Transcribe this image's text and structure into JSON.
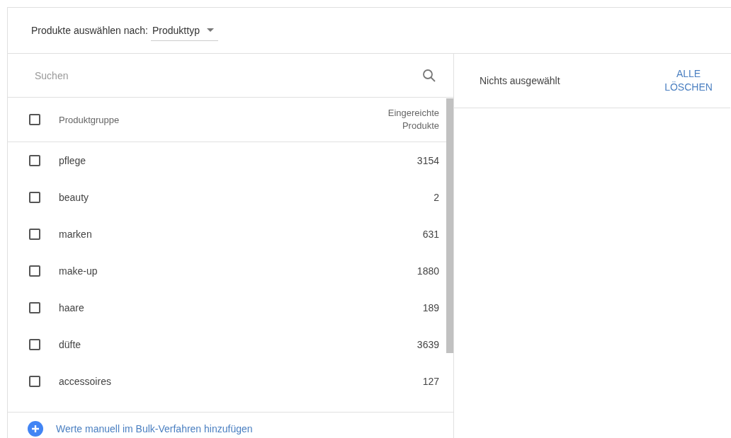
{
  "selector": {
    "label": "Produkte auswählen nach:",
    "value": "Produkttyp"
  },
  "search": {
    "placeholder": "Suchen"
  },
  "table": {
    "header_checked": false,
    "columns": [
      "Produktgruppe",
      "Eingereichte Produkte"
    ],
    "rows": [
      {
        "name": "pflege",
        "count": "3154",
        "checked": false
      },
      {
        "name": "beauty",
        "count": "2",
        "checked": false
      },
      {
        "name": "marken",
        "count": "631",
        "checked": false
      },
      {
        "name": "make-up",
        "count": "1880",
        "checked": false
      },
      {
        "name": "haare",
        "count": "189",
        "checked": false
      },
      {
        "name": "düfte",
        "count": "3639",
        "checked": false
      },
      {
        "name": "accessoires",
        "count": "127",
        "checked": false
      }
    ]
  },
  "add_link": "Werte manuell im Bulk-Verfahren hinzufügen",
  "selection": {
    "status": "Nichts ausgewählt",
    "clear_button": "ALLE LÖSCHEN"
  }
}
